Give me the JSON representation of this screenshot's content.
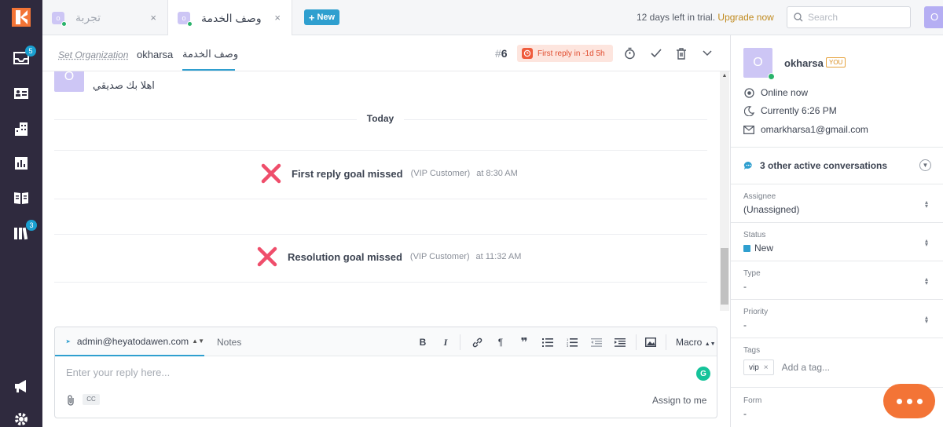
{
  "tabs": [
    {
      "avatar": "o",
      "label": "تجربة",
      "active": false
    },
    {
      "avatar": "o",
      "label": "وصف الخدمة",
      "active": true
    }
  ],
  "tab_close": "×",
  "new_button": "New",
  "trial": {
    "text": "12 days left in trial.",
    "upgrade": "Upgrade now"
  },
  "search": {
    "placeholder": "Search"
  },
  "me_avatar": "O",
  "rail_badges": {
    "inbox": "5",
    "kb": "3"
  },
  "conversation": {
    "set_org": "Set Organization",
    "user": "okharsa",
    "subject": "وصف الخدمة",
    "hash": "#",
    "number": "6",
    "sla": "First reply in -1d 5h"
  },
  "messages": {
    "avatar": "O",
    "text": "اهلا بك صديقي",
    "divider": "Today",
    "events": [
      {
        "title": "First reply goal missed",
        "tag": "(VIP Customer)",
        "time": "at 8:30 AM"
      },
      {
        "title": "Resolution goal missed",
        "tag": "(VIP Customer)",
        "time": "at 11:32 AM"
      }
    ]
  },
  "composer": {
    "from": "admin@heyatodawen.com",
    "notes": "Notes",
    "toolbar": {
      "bold": "B",
      "italic": "I",
      "paragraph": "¶",
      "quote": "❞"
    },
    "macro": "Macro",
    "placeholder": "Enter your reply here...",
    "cc": "CC",
    "assign_me": "Assign to me",
    "grammarly": "G"
  },
  "customer": {
    "avatar": "O",
    "name": "okharsa",
    "you_badge": "YOU",
    "status": "Online now",
    "local_time": "Currently 6:26 PM",
    "email": "omarkharsa1@gmail.com",
    "other_conversations": "3 other active conversations"
  },
  "fields": [
    {
      "label": "Assignee",
      "value": "(Unassigned)"
    },
    {
      "label": "Status",
      "value": "New"
    },
    {
      "label": "Type",
      "value": "-"
    },
    {
      "label": "Priority",
      "value": "-"
    }
  ],
  "tags": {
    "label": "Tags",
    "chips": [
      "vip"
    ],
    "add_placeholder": "Add a tag..."
  },
  "form": {
    "label": "Form",
    "value": "-"
  },
  "colors": {
    "accent": "#2f9fcf",
    "rail": "#2f2a3e",
    "sla": "#ef5b3c",
    "missed": "#ef4e6b",
    "chat": "#f37436"
  }
}
